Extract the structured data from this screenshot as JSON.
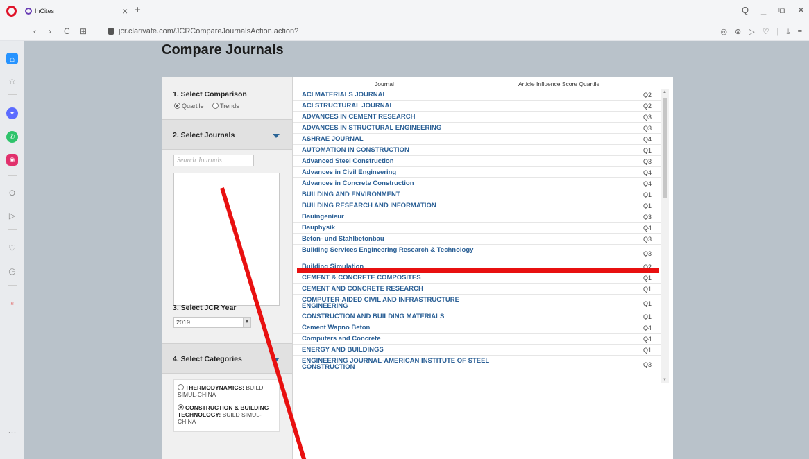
{
  "browser": {
    "tab_title": "InCites",
    "tab_close": "×",
    "new_tab": "+",
    "url": "jcr.clarivate.com/JCRCompareJournalsAction.action?",
    "nav": {
      "back": "‹",
      "forward": "›",
      "reload": "C",
      "grid": "⊞"
    },
    "window": {
      "search": "Q",
      "minimize": "_",
      "restore": "⧉",
      "close": "✕"
    },
    "ext_icons": "◎ ⊗ ▷ ♡ | ⤓ ≡"
  },
  "page": {
    "title": "Compare Journals",
    "sections": {
      "comparison": "1. Select Comparison",
      "journals": "2. Select Journals",
      "year": "3. Select JCR Year",
      "categories": "4. Select Categories"
    },
    "comparison_options": [
      {
        "label": "Quartile",
        "selected": true
      },
      {
        "label": "Trends",
        "selected": false
      }
    ],
    "search_placeholder": "Search Journals",
    "year_value": "2019",
    "categories": [
      {
        "name": "THERMODYNAMICS:",
        "detail": "BUILD SIMUL-CHINA",
        "selected": false
      },
      {
        "name": "CONSTRUCTION & BUILDING TECHNOLOGY:",
        "detail": "BUILD SIMUL-CHINA",
        "selected": true
      }
    ]
  },
  "table": {
    "columns": [
      "Journal",
      "Article Influence Score Quartile"
    ],
    "rows": [
      {
        "journal": "ACI MATERIALS JOURNAL",
        "quartile": "Q2"
      },
      {
        "journal": "ACI STRUCTURAL JOURNAL",
        "quartile": "Q2"
      },
      {
        "journal": "ADVANCES IN CEMENT RESEARCH",
        "quartile": "Q3"
      },
      {
        "journal": "ADVANCES IN STRUCTURAL ENGINEERING",
        "quartile": "Q3"
      },
      {
        "journal": "ASHRAE JOURNAL",
        "quartile": "Q4"
      },
      {
        "journal": "AUTOMATION IN CONSTRUCTION",
        "quartile": "Q1"
      },
      {
        "journal": "Advanced Steel Construction",
        "quartile": "Q3"
      },
      {
        "journal": "Advances in Civil Engineering",
        "quartile": "Q4"
      },
      {
        "journal": "Advances in Concrete Construction",
        "quartile": "Q4"
      },
      {
        "journal": "BUILDING AND ENVIRONMENT",
        "quartile": "Q1"
      },
      {
        "journal": "BUILDING RESEARCH AND INFORMATION",
        "quartile": "Q1"
      },
      {
        "journal": "Bauingenieur",
        "quartile": "Q3"
      },
      {
        "journal": "Bauphysik",
        "quartile": "Q4"
      },
      {
        "journal": "Beton- und Stahlbetonbau",
        "quartile": "Q3"
      },
      {
        "journal": "Building Services Engineering Research & Technology",
        "quartile": "Q3",
        "tall": true
      },
      {
        "journal": "Building Simulation",
        "quartile": "Q2"
      },
      {
        "journal": "CEMENT & CONCRETE COMPOSITES",
        "quartile": "Q1"
      },
      {
        "journal": "CEMENT AND CONCRETE RESEARCH",
        "quartile": "Q1"
      },
      {
        "journal": "COMPUTER-AIDED CIVIL AND INFRASTRUCTURE ENGINEERING",
        "quartile": "Q1",
        "tall": true
      },
      {
        "journal": "CONSTRUCTION AND BUILDING MATERIALS",
        "quartile": "Q1"
      },
      {
        "journal": "Cement Wapno Beton",
        "quartile": "Q4"
      },
      {
        "journal": "Computers and Concrete",
        "quartile": "Q4"
      },
      {
        "journal": "ENERGY AND BUILDINGS",
        "quartile": "Q1"
      },
      {
        "journal": "ENGINEERING JOURNAL-AMERICAN INSTITUTE OF STEEL CONSTRUCTION",
        "quartile": "Q3",
        "tall": true
      }
    ]
  },
  "colors": {
    "link": "#2a5f95",
    "annotation": "#e81010",
    "background": "#b9c2ca"
  }
}
